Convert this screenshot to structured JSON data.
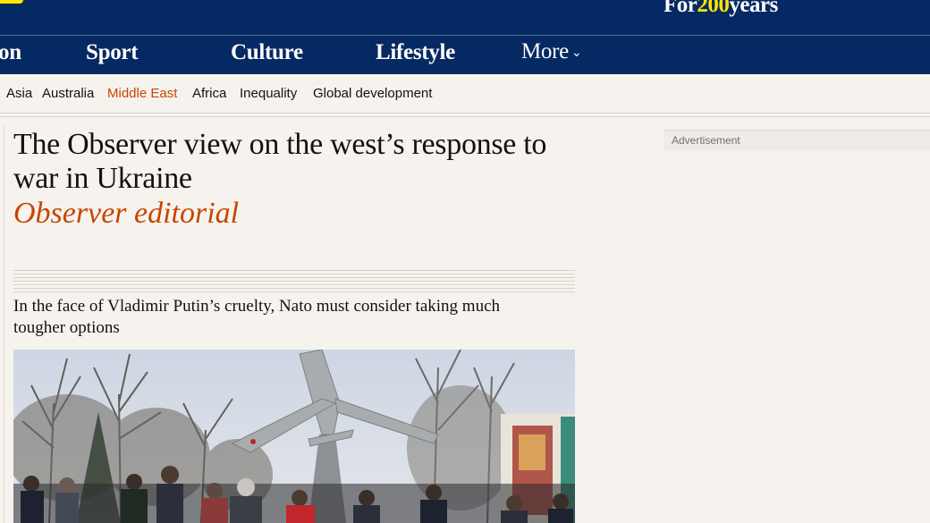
{
  "brand": {
    "tagline_prefix": "For",
    "tagline_accent": "200",
    "tagline_suffix": "years"
  },
  "nav": {
    "items": [
      {
        "label": "on"
      },
      {
        "label": "Sport"
      },
      {
        "label": "Culture"
      },
      {
        "label": "Lifestyle"
      }
    ],
    "more_label": "More"
  },
  "subnav": {
    "items": [
      {
        "label": "Asia",
        "active": false
      },
      {
        "label": "Australia",
        "active": false
      },
      {
        "label": "Middle East",
        "active": true
      },
      {
        "label": "Africa",
        "active": false
      },
      {
        "label": "Inequality",
        "active": false
      },
      {
        "label": "Global development",
        "active": false
      }
    ]
  },
  "article": {
    "headline": "The Observer view on the west’s response to war in Ukraine",
    "byline": "Observer editorial",
    "standfirst": "In the face of Vladimir Putin’s cruelty, Nato must consider taking much tougher options"
  },
  "ad": {
    "label": "Advertisement"
  },
  "colors": {
    "brand_blue": "#052962",
    "accent_yellow": "#ffe500",
    "opinion_orange": "#c74600",
    "background": "#f6f3ee"
  },
  "icons": {
    "more_chevron": "chevron-down-icon"
  }
}
